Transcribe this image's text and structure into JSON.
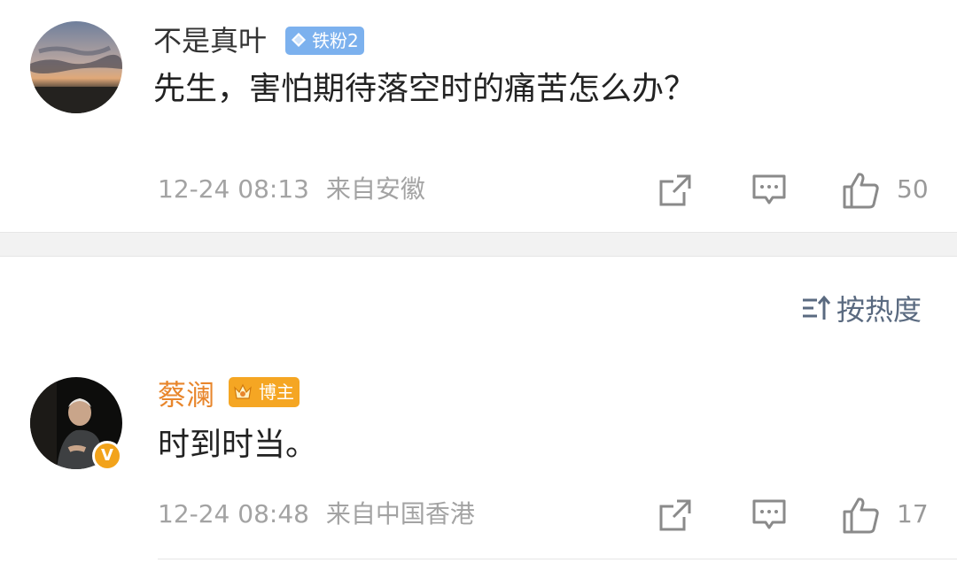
{
  "comments": [
    {
      "username": "不是真叶",
      "badge": "铁粉2",
      "text": "先生，害怕期待落空时的痛苦怎么办？",
      "time": "12-24 08:13",
      "location": "来自安徽",
      "likes": "50"
    },
    {
      "username": "蔡澜",
      "badge": "博主",
      "verified_badge": "V",
      "text": "时到时当。",
      "time": "12-24 08:48",
      "location": "来自中国香港",
      "likes": "17"
    }
  ],
  "sort": {
    "label": "按热度"
  },
  "colors": {
    "accent_orange": "#e8862c",
    "fan_badge": "#7cb1ee",
    "host_badge": "#f5a623",
    "meta_gray": "#a3a3a3"
  }
}
